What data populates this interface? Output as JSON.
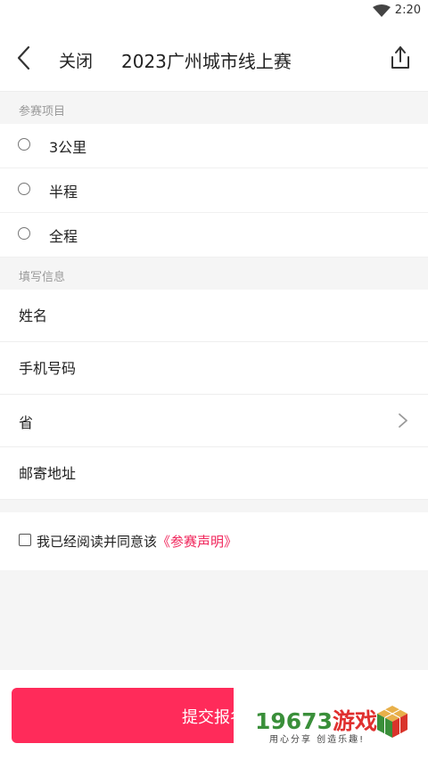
{
  "status_bar": {
    "time": "2:20"
  },
  "header": {
    "close_label": "关闭",
    "title": "2023广州城市线上赛"
  },
  "entry_section": {
    "header": "参赛项目",
    "options": [
      {
        "label": "3公里"
      },
      {
        "label": "半程"
      },
      {
        "label": "全程"
      }
    ]
  },
  "info_section": {
    "header": "填写信息",
    "fields": {
      "name_placeholder": "姓名",
      "phone_placeholder": "手机号码",
      "province_label": "省",
      "address_placeholder": "邮寄地址"
    }
  },
  "agreement": {
    "text": "我已经阅读并同意该",
    "link": "《参赛声明》"
  },
  "submit": {
    "label": "提交报名"
  },
  "watermark": {
    "number": "19673",
    "chinese": "游戏",
    "slogan": "用心分享 创造乐趣!"
  },
  "colors": {
    "accent": "#ff2b5a",
    "link": "#f0245a",
    "section_bg": "#f5f5f5"
  }
}
